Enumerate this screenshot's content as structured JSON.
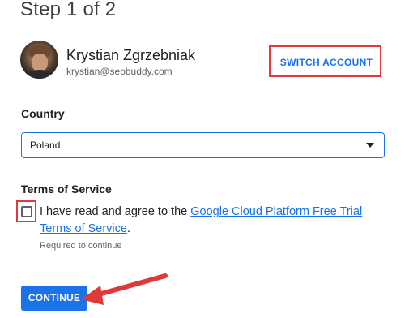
{
  "page": {
    "step_title": "Step 1 of 2"
  },
  "account": {
    "name": "Krystian Zgrzebniak",
    "email": "krystian@seobuddy.com",
    "switch_label": "SWITCH ACCOUNT"
  },
  "country": {
    "label": "Country",
    "selected": "Poland"
  },
  "terms": {
    "label": "Terms of Service",
    "agree_prefix": "I have read and agree to the ",
    "link_text": "Google Cloud Platform Free Trial Terms of Service",
    "agree_suffix": ".",
    "checked": false,
    "required_text": "Required to continue"
  },
  "actions": {
    "continue_label": "CONTINUE"
  },
  "annotations": {
    "highlight_color": "#e1383a",
    "accent_color": "#1a73e8"
  }
}
